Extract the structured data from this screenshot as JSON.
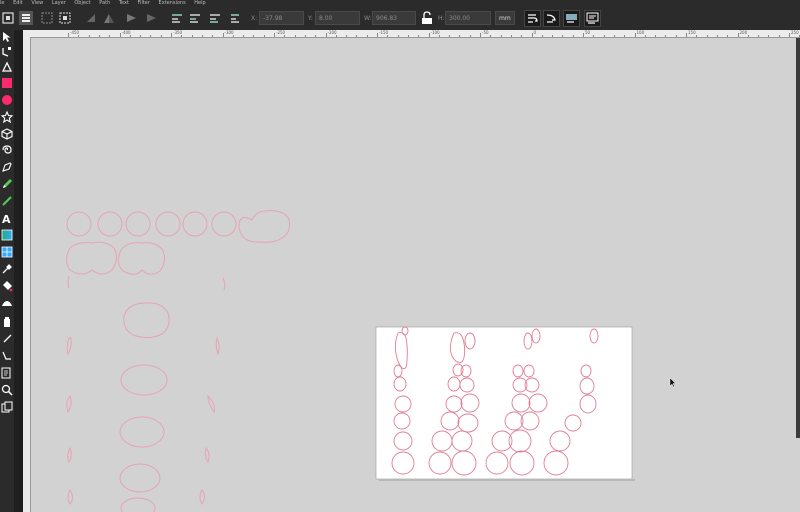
{
  "menu": [
    "le",
    "Edit",
    "View",
    "Layer",
    "Object",
    "Path",
    "Text",
    "Filter",
    "Extensions",
    "Help"
  ],
  "toolbar": {
    "x_label": "X:",
    "x_value": "-37.98",
    "y_label": "Y:",
    "y_value": "8.00",
    "w_label": "W:",
    "w_value": "906.83",
    "h_label": "H:",
    "h_value": "300.00",
    "unit": "mm"
  },
  "hruler_labels": [
    "-450",
    "-400",
    "-350",
    "-300",
    "-250",
    "-200",
    "-150",
    "-100",
    "-50",
    "0",
    "50",
    "100",
    "150",
    "200",
    "250",
    "300",
    "350"
  ],
  "tools": [
    "selector-arrow-icon",
    "node-tool-icon",
    "tweak-tool-icon",
    "rectangle-tool-icon",
    "circle-tool-icon",
    "star-tool-icon",
    "3d-box-tool-icon",
    "spiral-tool-icon",
    "pen-tool-icon",
    "pencil-tool-icon",
    "calligraphy-tool-icon",
    "text-tool-icon",
    "gradient-tool-icon",
    "mesh-tool-icon",
    "dropper-tool-icon",
    "paint-bucket-icon",
    "spray-tool-icon",
    "eraser-tool-icon",
    "connector-tool-icon",
    "measure-tool-icon",
    "zoom-tool-icon",
    "pages-tool-icon"
  ],
  "colors": {
    "shape_stroke": "#e05a7a",
    "accent": "#ff2a6d",
    "chrome": "#2b2b2b"
  }
}
